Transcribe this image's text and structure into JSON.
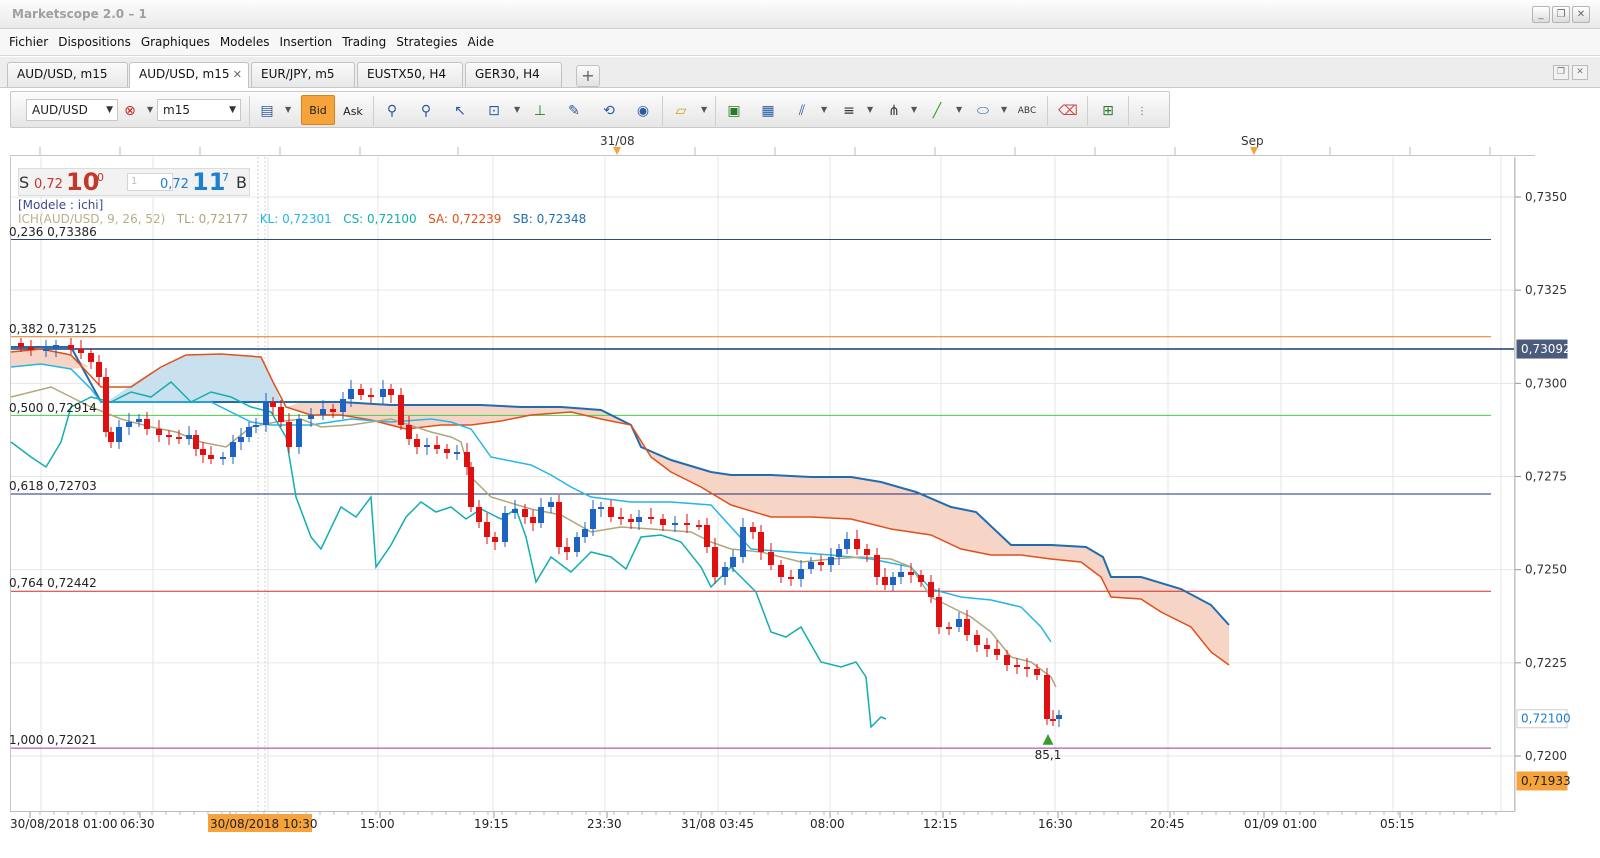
{
  "window": {
    "title": "Marketscope 2.0 – 1"
  },
  "menu": [
    "Fichier",
    "Dispositions",
    "Graphiques",
    "Modeles",
    "Insertion",
    "Trading",
    "Strategies",
    "Aide"
  ],
  "tabs": [
    {
      "label": "AUD/USD, m15",
      "active": false,
      "closable": false
    },
    {
      "label": "AUD/USD, m15",
      "active": true,
      "closable": true
    },
    {
      "label": "EUR/JPY, m5",
      "active": false,
      "closable": false
    },
    {
      "label": "EUSTX50, H4",
      "active": false,
      "closable": false
    },
    {
      "label": "GER30, H4",
      "active": false,
      "closable": false
    }
  ],
  "toolbar": {
    "instrument": "AUD/USD",
    "timeframe": "m15",
    "bid_label": "Bid",
    "ask_label": "Ask",
    "icons": [
      "chart-type-icon",
      "crosshair-icon",
      "zoom-in-icon",
      "zoom-out-icon",
      "cursor-icon",
      "zoom-range-icon",
      "level-icon",
      "note-icon",
      "sync-icon",
      "globe-icon",
      "ruler-icon",
      "image-icon",
      "window-icon",
      "fibonacci-icon",
      "lines-icon",
      "pitchfork-icon",
      "trendline-icon",
      "ellipse-icon",
      "text-icon",
      "eraser-icon",
      "hierarchy-icon",
      "more-icon"
    ]
  },
  "quote": {
    "sell_label": "S",
    "sell_prefix": "0,72",
    "sell_big": "10",
    "sell_sup": "0",
    "amount_placeholder": "1",
    "buy_prefix": "0,72",
    "buy_big": "11",
    "buy_sup": "7",
    "buy_label": "B"
  },
  "model_label": "[Modele : ichi]",
  "indicator": {
    "name": "ICH(AUD/USD, 9, 26, 52)",
    "tl": "TL: 0,72177",
    "kl": "KL: 0,72301",
    "cs": "CS: 0,72100",
    "sa": "SA: 0,72239",
    "sb": "SB: 0,72348",
    "colors": {
      "name": "#b7b08a",
      "tl": "#b1a67a",
      "kl": "#27b5e8",
      "cs": "#12aeb0",
      "sa": "#e0501b",
      "sb": "#1f6db0"
    }
  },
  "fibonacci": [
    {
      "label": "0,236 0,73386",
      "price": 0.73386,
      "color": "#34497a"
    },
    {
      "label": "0,382 0,73125",
      "price": 0.73125,
      "color": "#e07a1e"
    },
    {
      "label": "0,500 0,72914",
      "price": 0.72914,
      "color": "#45d045"
    },
    {
      "label": "0,618 0,72703",
      "price": 0.72703,
      "color": "#1d2f7a"
    },
    {
      "label": "0,764 0,72442",
      "price": 0.72442,
      "color": "#d62a2a"
    },
    {
      "label": "1,000 0,72021",
      "price": 0.72021,
      "color": "#a0349a"
    }
  ],
  "price_axis": {
    "ticks": [
      "0,7350",
      "0,7325",
      "0,7300",
      "0,7275",
      "0,7250",
      "0,7225",
      "0,7200"
    ],
    "markers": [
      {
        "value": "0,73092",
        "bg": "#4b5b7c",
        "fg": "#ffffff"
      },
      {
        "value": "0,72100",
        "bg": "#ffffff",
        "fg": "#1e7fd0"
      },
      {
        "value": "0,71933",
        "bg": "#f6a33c",
        "fg": "#222222"
      }
    ]
  },
  "time_axis": {
    "labels": [
      "30/08/2018 01:00",
      "06:30",
      "30/08/2018 10:30",
      "15:00",
      "19:15",
      "23:30",
      "31/08 03:45",
      "08:00",
      "12:15",
      "16:30",
      "20:45",
      "01/09 01:00",
      "05:15"
    ],
    "top_labels": [
      "31/08",
      "Sep"
    ]
  },
  "signal": {
    "label": "85,1"
  },
  "chart_data": {
    "type": "candlestick",
    "instrument": "AUD/USD",
    "timeframe": "m15",
    "ylim": [
      0.719,
      0.7365
    ],
    "fib_prices": [
      0.73386,
      0.73125,
      0.72914,
      0.72703,
      0.72442,
      0.72021
    ],
    "current_price": 0.721,
    "line_price": 0.73092
  }
}
